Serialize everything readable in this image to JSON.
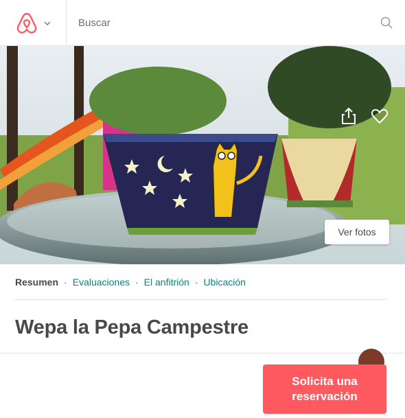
{
  "header": {
    "logo_icon": "airbnb-logo-icon",
    "dropdown_icon": "chevron-down-icon",
    "search": {
      "placeholder": "Buscar",
      "icon": "search-icon"
    }
  },
  "hero": {
    "share_icon": "share-icon",
    "favorite_icon": "heart-icon",
    "photos_button": "Ver fotos"
  },
  "subnav": {
    "items": [
      {
        "label": "Resumen",
        "active": true
      },
      {
        "label": "Evaluaciones",
        "active": false
      },
      {
        "label": "El anfitrión",
        "active": false
      },
      {
        "label": "Ubicación",
        "active": false
      }
    ],
    "separator": "·"
  },
  "listing": {
    "title": "Wepa la Pepa Campestre"
  },
  "footer": {
    "reserve_button": "Solicita una reservación"
  },
  "colors": {
    "brand": "#ff5a5f",
    "link": "#008489",
    "text": "#484848"
  }
}
